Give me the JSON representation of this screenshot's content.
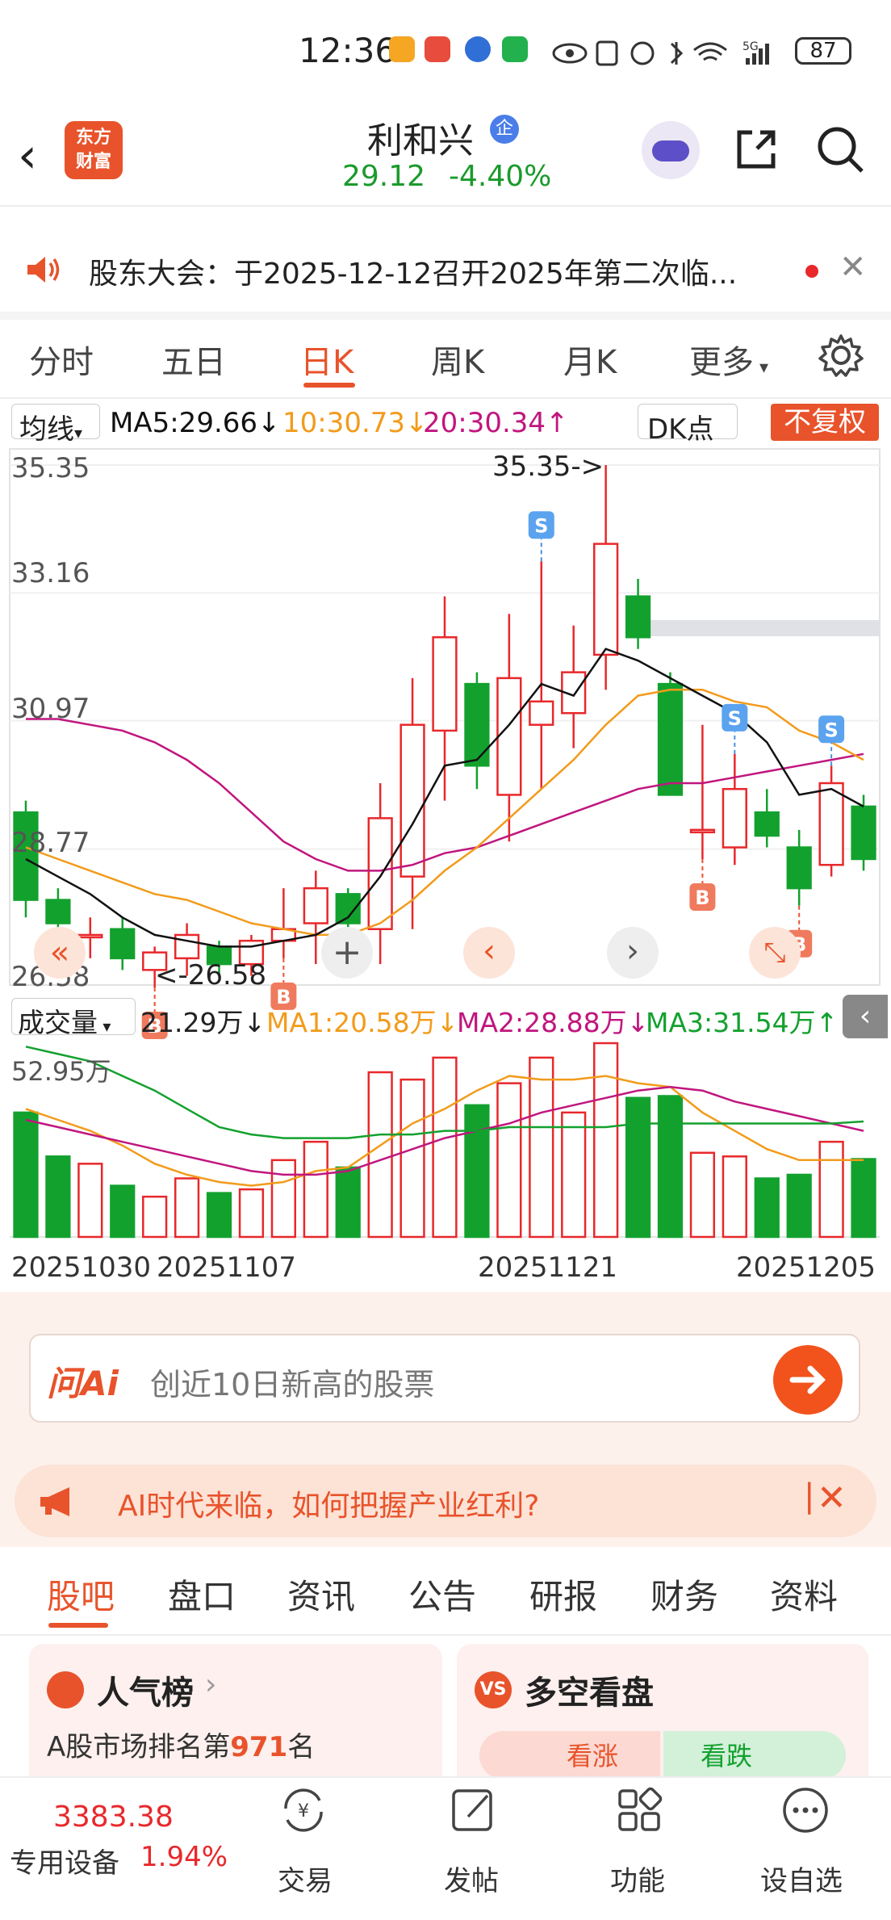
{
  "status_bar": {
    "time": "12:36",
    "signal": "5G",
    "battery": "87"
  },
  "header": {
    "logo_line1": "东方",
    "logo_line2": "财富",
    "stock_name": "利和兴",
    "badge": "企",
    "price": "29.12",
    "change_pct": "-4.40%"
  },
  "notice": {
    "text": "股东大会：于2025-12-12召开2025年第二次临..."
  },
  "tabs": [
    {
      "label": "分时"
    },
    {
      "label": "五日"
    },
    {
      "label": "日K"
    },
    {
      "label": "周K"
    },
    {
      "label": "月K"
    },
    {
      "label": "更多"
    }
  ],
  "ma_bar": {
    "selector": "均线",
    "ma5": "MA5:29.66↓",
    "ma10": "10:30.73↓",
    "ma20": "20:30.34↑",
    "dk": "DK点",
    "fuquan": "不复权"
  },
  "price_axis": [
    "35.35",
    "33.16",
    "30.97",
    "28.77",
    "26.58"
  ],
  "annotations": {
    "high": "35.35->",
    "low": "<-26.58"
  },
  "signal_labels": {
    "buy": "B",
    "sell": "S"
  },
  "volume_bar": {
    "selector": "成交量",
    "vol": "21.29万↓",
    "ma1": "MA1:20.58万↓",
    "ma2": "MA2:28.88万↓",
    "ma3": "MA3:31.54万↑",
    "axis_top": "52.95万"
  },
  "dates": [
    "20251030",
    "20251107",
    "20251121",
    "20251205"
  ],
  "colors": {
    "up": "#e8282b",
    "down": "#13a12e",
    "ma5": "#111111",
    "ma10": "#f29b1b",
    "ma20": "#c0167e",
    "accent": "#e8532b"
  },
  "chart_data": {
    "type": "candlestick",
    "ylim": [
      26.58,
      35.35
    ],
    "candles": [
      {
        "o": 29.4,
        "c": 27.9,
        "h": 29.6,
        "l": 27.6
      },
      {
        "o": 27.9,
        "c": 27.5,
        "h": 28.1,
        "l": 27.2
      },
      {
        "o": 27.3,
        "c": 27.3,
        "h": 27.6,
        "l": 26.9
      },
      {
        "o": 27.4,
        "c": 26.9,
        "h": 27.6,
        "l": 26.7
      },
      {
        "o": 26.7,
        "c": 27.0,
        "h": 27.1,
        "l": 26.4
      },
      {
        "o": 26.9,
        "c": 27.3,
        "h": 27.5,
        "l": 26.6
      },
      {
        "o": 27.1,
        "c": 26.8,
        "h": 27.2,
        "l": 26.6
      },
      {
        "o": 26.8,
        "c": 27.2,
        "h": 27.3,
        "l": 26.6
      },
      {
        "o": 27.2,
        "c": 27.4,
        "h": 28.1,
        "l": 26.9
      },
      {
        "o": 27.5,
        "c": 28.1,
        "h": 28.4,
        "l": 26.8
      },
      {
        "o": 28.0,
        "c": 27.5,
        "h": 28.1,
        "l": 27.4
      },
      {
        "o": 27.4,
        "c": 29.3,
        "h": 29.9,
        "l": 26.8
      },
      {
        "o": 28.3,
        "c": 30.9,
        "h": 31.7,
        "l": 27.4
      },
      {
        "o": 30.8,
        "c": 32.4,
        "h": 33.1,
        "l": 29.6
      },
      {
        "o": 31.6,
        "c": 30.2,
        "h": 31.8,
        "l": 29.8
      },
      {
        "o": 29.7,
        "c": 31.7,
        "h": 32.8,
        "l": 28.9
      },
      {
        "o": 30.9,
        "c": 31.3,
        "h": 33.7,
        "l": 29.8
      },
      {
        "o": 31.1,
        "c": 31.8,
        "h": 32.6,
        "l": 30.5
      },
      {
        "o": 32.1,
        "c": 34.0,
        "h": 35.35,
        "l": 31.5
      },
      {
        "o": 33.1,
        "c": 32.4,
        "h": 33.4,
        "l": 32.2
      },
      {
        "o": 31.6,
        "c": 29.7,
        "h": 31.8,
        "l": 29.7
      },
      {
        "o": 29.1,
        "c": 29.1,
        "h": 30.9,
        "l": 28.6
      },
      {
        "o": 28.8,
        "c": 29.8,
        "h": 30.4,
        "l": 28.5
      },
      {
        "o": 29.4,
        "c": 29.0,
        "h": 29.8,
        "l": 28.8
      },
      {
        "o": 28.8,
        "c": 28.1,
        "h": 29.1,
        "l": 27.8
      },
      {
        "o": 28.5,
        "c": 29.9,
        "h": 30.2,
        "l": 28.3
      },
      {
        "o": 29.5,
        "c": 28.6,
        "h": 29.7,
        "l": 28.4
      }
    ],
    "ma5": [
      28.6,
      28.3,
      28.0,
      27.6,
      27.3,
      27.2,
      27.1,
      27.1,
      27.2,
      27.3,
      27.6,
      28.3,
      29.2,
      30.2,
      30.3,
      30.9,
      31.6,
      31.4,
      32.2,
      32.0,
      31.7,
      31.4,
      31.1,
      30.6,
      29.7,
      29.8,
      29.5
    ],
    "ma10": [
      28.8,
      28.6,
      28.4,
      28.2,
      28.0,
      27.9,
      27.7,
      27.5,
      27.4,
      27.3,
      27.3,
      27.5,
      27.9,
      28.4,
      28.8,
      29.3,
      29.8,
      30.3,
      30.9,
      31.4,
      31.5,
      31.5,
      31.3,
      31.2,
      30.8,
      30.6,
      30.3
    ],
    "ma20": [
      31.0,
      31.0,
      30.9,
      30.8,
      30.6,
      30.3,
      29.9,
      29.4,
      28.9,
      28.6,
      28.4,
      28.4,
      28.5,
      28.7,
      28.8,
      29.0,
      29.2,
      29.4,
      29.6,
      29.8,
      29.9,
      29.9,
      30.0,
      30.1,
      30.2,
      30.3,
      30.4
    ],
    "volume": {
      "unit": "万",
      "ylim": [
        0,
        52.95
      ],
      "values": [
        34,
        22,
        20,
        14,
        11,
        16,
        12,
        13,
        21,
        26,
        19,
        45,
        43,
        49,
        36,
        42,
        49,
        34,
        52.95,
        38,
        38.5,
        23,
        22,
        16,
        17,
        26,
        21.29
      ],
      "ma1": [
        35,
        32,
        29,
        25,
        20,
        17,
        15,
        14,
        15,
        18,
        19,
        25,
        31,
        35,
        40,
        44,
        43,
        43,
        44,
        42,
        41,
        34,
        29,
        24,
        21,
        21,
        21
      ],
      "ma2": [
        32,
        30,
        28,
        26,
        24,
        22,
        20,
        18,
        17,
        17,
        18,
        21,
        24,
        27,
        29,
        31,
        34,
        36,
        38,
        40,
        41,
        40,
        37,
        35,
        33,
        31,
        29
      ],
      "ma3": [
        52,
        50,
        48,
        44,
        40,
        35,
        30,
        28,
        27,
        27,
        27,
        28,
        28,
        29,
        29,
        30,
        30,
        30,
        30,
        31,
        31,
        31,
        31,
        31,
        31,
        31,
        31.54
      ]
    },
    "signals": [
      {
        "index": 4,
        "type": "B"
      },
      {
        "index": 8,
        "type": "B"
      },
      {
        "index": 16,
        "type": "S"
      },
      {
        "index": 22,
        "type": "S"
      },
      {
        "index": 21,
        "type": "B"
      },
      {
        "index": 25,
        "type": "S"
      },
      {
        "index": 24,
        "type": "B"
      }
    ]
  },
  "ai_search": {
    "logo": "问Ai",
    "placeholder": "创近10日新高的股票"
  },
  "banner": {
    "text": "AI时代来临，如何把握产业红利?"
  },
  "sub_tabs": [
    {
      "label": "股吧"
    },
    {
      "label": "盘口"
    },
    {
      "label": "资讯"
    },
    {
      "label": "公告"
    },
    {
      "label": "研报"
    },
    {
      "label": "财务"
    },
    {
      "label": "资料"
    }
  ],
  "cards": {
    "popularity": {
      "title": "人气榜",
      "rank_text_prefix": "A股市场排名第",
      "rank": "971",
      "rank_suffix": "名"
    },
    "bull_bear": {
      "title": "多空看盘",
      "bull": "看涨",
      "bear": "看跌"
    }
  },
  "bottom_nav": {
    "index_value": "3383.38",
    "index_name": "专用设备",
    "index_change": "1.94%",
    "items": [
      {
        "label": "交易"
      },
      {
        "label": "发帖"
      },
      {
        "label": "功能"
      },
      {
        "label": "设自选"
      }
    ]
  }
}
